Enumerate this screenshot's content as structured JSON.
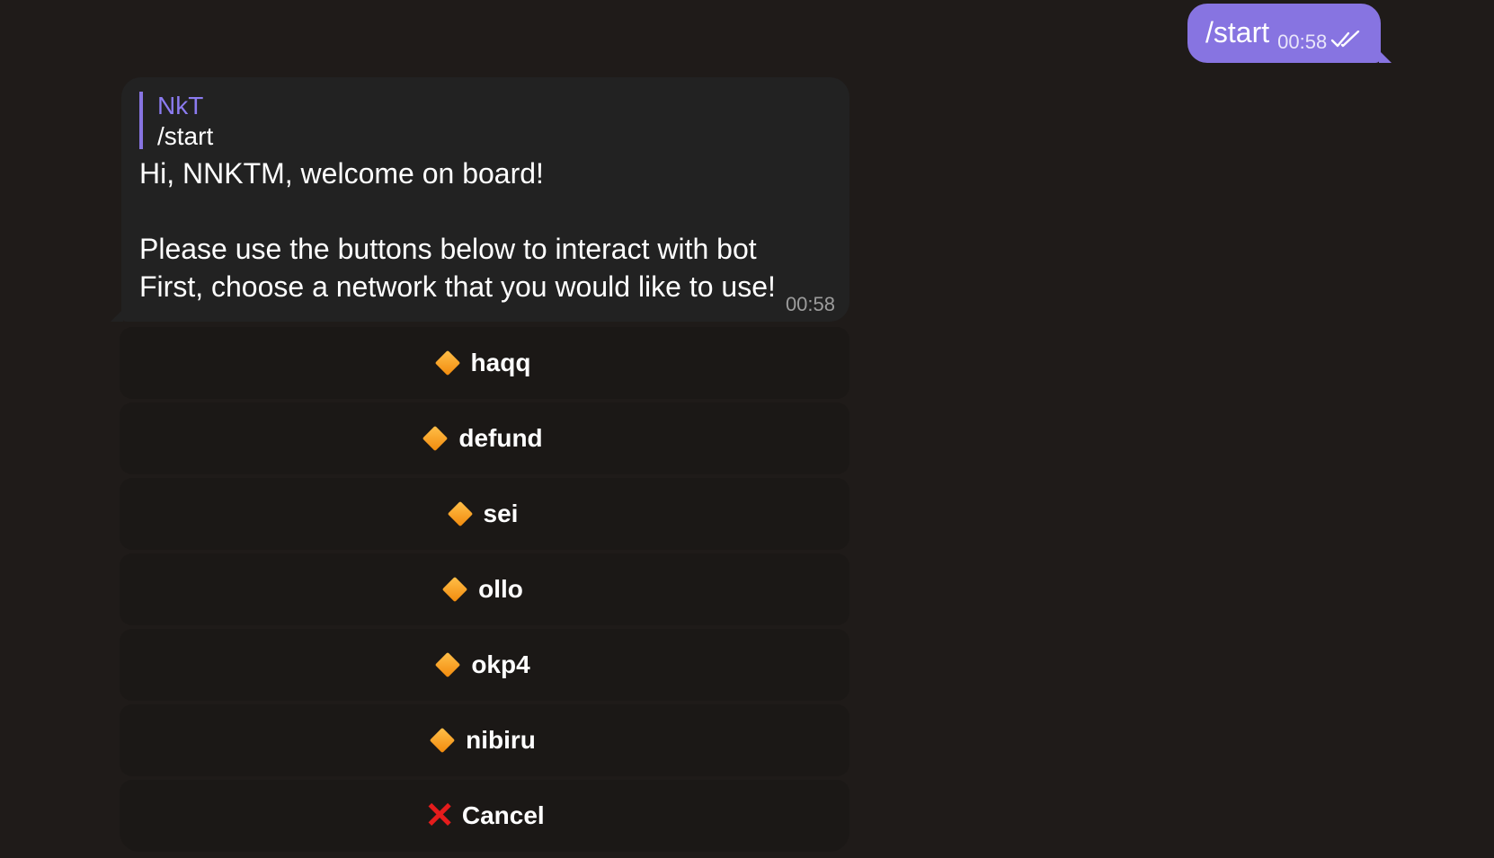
{
  "outgoing": {
    "text": "/start",
    "time": "00:58",
    "status_icon": "double-check-icon"
  },
  "incoming": {
    "reply": {
      "author": "NkT",
      "text": "/start"
    },
    "lines": [
      "Hi, NNKTM, welcome on board!",
      "",
      "Please use the buttons below to interact with bot",
      "First, choose a network that you would like to use!"
    ],
    "time": "00:58"
  },
  "keyboard": {
    "buttons": [
      {
        "icon": "orange-diamond-icon",
        "label": "haqq"
      },
      {
        "icon": "orange-diamond-icon",
        "label": "defund"
      },
      {
        "icon": "orange-diamond-icon",
        "label": "sei"
      },
      {
        "icon": "orange-diamond-icon",
        "label": "ollo"
      },
      {
        "icon": "orange-diamond-icon",
        "label": "okp4"
      },
      {
        "icon": "orange-diamond-icon",
        "label": "nibiru"
      },
      {
        "icon": "cross-mark-icon",
        "label": "Cancel"
      }
    ]
  },
  "colors": {
    "background": "#1f1b19",
    "outgoing_bubble": "#8774e1",
    "incoming_bubble": "#222222",
    "reply_accent": "#8b7bf0",
    "button_bg": "#1b1816",
    "diamond": "#f5a623",
    "cancel_cross": "#e51c1c"
  }
}
